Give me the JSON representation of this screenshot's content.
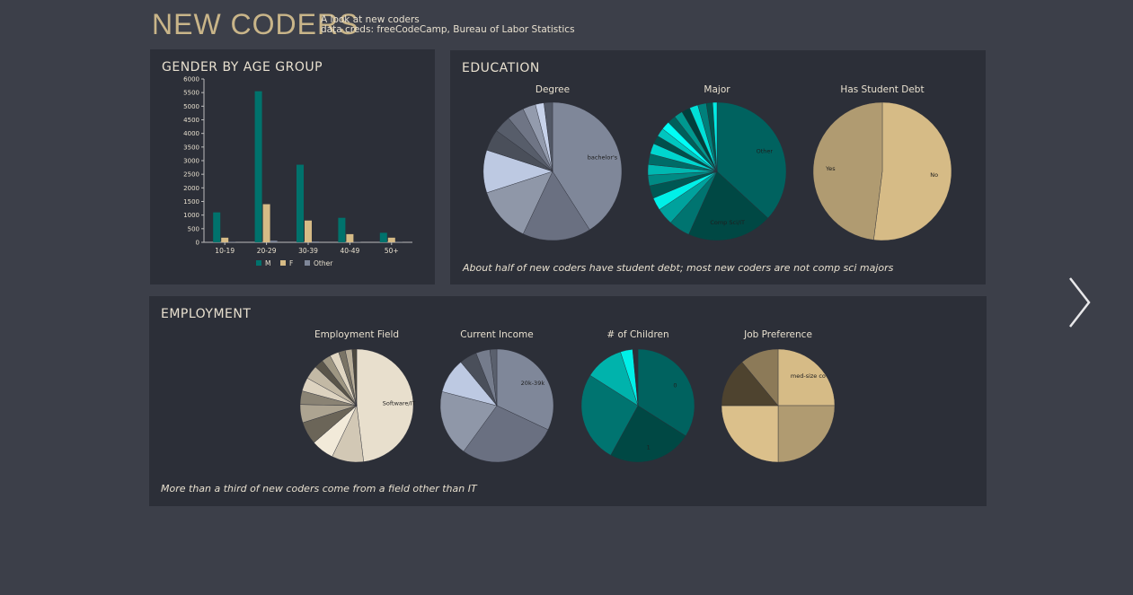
{
  "header": {
    "title": "NEW CODERS",
    "subtitle_line1": "A look at new coders",
    "subtitle_line2": "data creds: freeCodeCamp, Bureau of Labor Statistics"
  },
  "panels": {
    "gender": {
      "title": "GENDER BY AGE GROUP"
    },
    "education": {
      "title": "EDUCATION",
      "caption": "About half of new coders have student debt; most new coders are not comp sci majors"
    },
    "employment": {
      "title": "EMPLOYMENT",
      "caption": "More than a third of new coders come from a field other than IT"
    }
  },
  "nav": {
    "next_icon": "chevron-right-icon"
  },
  "chart_data": [
    {
      "id": "gender",
      "type": "bar",
      "title": "GENDER BY AGE GROUP",
      "categories": [
        "10-19",
        "20-29",
        "30-39",
        "40-49",
        "50+"
      ],
      "series": [
        {
          "name": "M",
          "color": "#00726c",
          "values": [
            1100,
            5550,
            2850,
            900,
            350
          ]
        },
        {
          "name": "F",
          "color": "#d6bb86",
          "values": [
            170,
            1400,
            800,
            300,
            170
          ]
        },
        {
          "name": "Other",
          "color": "#7f8799",
          "values": [
            20,
            60,
            30,
            15,
            10
          ]
        }
      ],
      "ylim": [
        0,
        6000
      ],
      "yticks": [
        0,
        500,
        1000,
        1500,
        2000,
        2500,
        3000,
        3500,
        4000,
        4500,
        5000,
        5500,
        6000
      ],
      "legend": "bottom"
    },
    {
      "id": "degree",
      "type": "pie",
      "title": "Degree",
      "slices": [
        {
          "label": "bachelor's",
          "value": 41,
          "color": "#7f8799"
        },
        {
          "label": "",
          "value": 16,
          "color": "#6a7081"
        },
        {
          "label": "",
          "value": 13,
          "color": "#8f97a8"
        },
        {
          "label": "",
          "value": 10,
          "color": "#bdc9e2"
        },
        {
          "label": "",
          "value": 5,
          "color": "#4a4f5a"
        },
        {
          "label": "",
          "value": 4,
          "color": "#575d6a"
        },
        {
          "label": "",
          "value": 4,
          "color": "#6f7585"
        },
        {
          "label": "",
          "value": 3,
          "color": "#939bad"
        },
        {
          "label": "",
          "value": 2,
          "color": "#c7d2ea"
        },
        {
          "label": "",
          "value": 2,
          "color": "#525866"
        }
      ]
    },
    {
      "id": "major",
      "type": "pie",
      "title": "Major",
      "slices": [
        {
          "label": "Other",
          "value": 37,
          "color": "#00625f"
        },
        {
          "label": "Comp Sci/IT",
          "value": 20,
          "color": "#004844"
        },
        {
          "label": "",
          "value": 5,
          "color": "#007470"
        },
        {
          "label": "",
          "value": 4,
          "color": "#00a29d"
        },
        {
          "label": "",
          "value": 3,
          "color": "#00f0e8"
        },
        {
          "label": "",
          "value": 3,
          "color": "#005753"
        },
        {
          "label": "",
          "value": 2.5,
          "color": "#008a84"
        },
        {
          "label": "",
          "value": 2.5,
          "color": "#00b8b1"
        },
        {
          "label": "",
          "value": 2.5,
          "color": "#006b67"
        },
        {
          "label": "",
          "value": 2.5,
          "color": "#00d6cf"
        },
        {
          "label": "",
          "value": 2,
          "color": "#004f4b"
        },
        {
          "label": "",
          "value": 2,
          "color": "#00c6bf"
        },
        {
          "label": "",
          "value": 2,
          "color": "#00fff6"
        },
        {
          "label": "",
          "value": 2,
          "color": "#005f5b"
        },
        {
          "label": "",
          "value": 2,
          "color": "#00988f"
        },
        {
          "label": "",
          "value": 2,
          "color": "#003f3c"
        },
        {
          "label": "",
          "value": 2,
          "color": "#00e0d8"
        },
        {
          "label": "",
          "value": 2,
          "color": "#00807b"
        },
        {
          "label": "",
          "value": 1.5,
          "color": "#00564f"
        },
        {
          "label": "",
          "value": 1,
          "color": "#00ece4"
        }
      ]
    },
    {
      "id": "debt",
      "type": "pie",
      "title": "Has Student Debt",
      "slices": [
        {
          "label": "No",
          "value": 52,
          "color": "#d6bb86"
        },
        {
          "label": "Yes",
          "value": 48,
          "color": "#b09b71"
        }
      ]
    },
    {
      "id": "field",
      "type": "pie",
      "title": "Employment Field",
      "slices": [
        {
          "label": "Software/IT",
          "value": 37,
          "color": "#e8dfcd"
        },
        {
          "label": "",
          "value": 7,
          "color": "#d2c8b5"
        },
        {
          "label": "",
          "value": 5,
          "color": "#f2ead9"
        },
        {
          "label": "",
          "value": 5,
          "color": "#6b6558"
        },
        {
          "label": "",
          "value": 4,
          "color": "#ada491"
        },
        {
          "label": "",
          "value": 3,
          "color": "#8a8374"
        },
        {
          "label": "",
          "value": 3,
          "color": "#ddd3c0"
        },
        {
          "label": "",
          "value": 3,
          "color": "#c3b9a5"
        },
        {
          "label": "",
          "value": 2,
          "color": "#5a554a"
        },
        {
          "label": "",
          "value": 2,
          "color": "#9e9682"
        },
        {
          "label": "",
          "value": 2,
          "color": "#e0d6c2"
        },
        {
          "label": "",
          "value": 1.5,
          "color": "#7a7466"
        },
        {
          "label": "",
          "value": 1.5,
          "color": "#b8ae99"
        },
        {
          "label": "",
          "value": 1,
          "color": "#4d4940"
        }
      ]
    },
    {
      "id": "income",
      "type": "pie",
      "title": "Current Income",
      "slices": [
        {
          "label": "20k-39k",
          "value": 32,
          "color": "#7f8799"
        },
        {
          "label": "",
          "value": 28,
          "color": "#6a7081"
        },
        {
          "label": "",
          "value": 19,
          "color": "#8f97a8"
        },
        {
          "label": "",
          "value": 10,
          "color": "#bdc9e2"
        },
        {
          "label": "",
          "value": 5,
          "color": "#4a4f5a"
        },
        {
          "label": "",
          "value": 4,
          "color": "#757c8c"
        },
        {
          "label": "",
          "value": 2,
          "color": "#5a606d"
        }
      ]
    },
    {
      "id": "children",
      "type": "pie",
      "title": "# of Children",
      "slices": [
        {
          "label": "0",
          "value": 34,
          "color": "#00625f"
        },
        {
          "label": "1",
          "value": 24,
          "color": "#004844"
        },
        {
          "label": "",
          "value": 26,
          "color": "#007470"
        },
        {
          "label": "",
          "value": 11,
          "color": "#00b3ac"
        },
        {
          "label": "",
          "value": 3.5,
          "color": "#00f0e8"
        },
        {
          "label": "",
          "value": 1.5,
          "color": "#2c2f38"
        }
      ]
    },
    {
      "id": "jobpref",
      "type": "pie",
      "title": "Job Preference",
      "slices": [
        {
          "label": "med-size co",
          "value": 25,
          "color": "#d6bb86"
        },
        {
          "label": "",
          "value": 25,
          "color": "#b09b71"
        },
        {
          "label": "",
          "value": 25,
          "color": "#dbc08b"
        },
        {
          "label": "",
          "value": 14,
          "color": "#4e432f"
        },
        {
          "label": "",
          "value": 11,
          "color": "#8c7a58"
        }
      ]
    }
  ]
}
